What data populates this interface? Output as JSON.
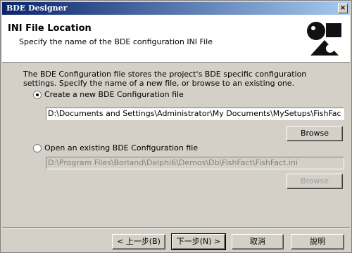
{
  "window": {
    "title": "BDE Designer",
    "close": "×"
  },
  "header": {
    "title": "INI File Location",
    "subtitle": "Specify the name of the BDE configuration INI File"
  },
  "body": {
    "description": "The BDE Configuration file stores the project's BDE specific configuration settings. Specify the name of a new file, or browse to an existing one.",
    "option_create": {
      "label": "Create a new BDE Configuration file",
      "selected": true,
      "path": "D:\\Documents and Settings\\Administrator\\My Documents\\MySetups\\FishFac",
      "browse": "Browse"
    },
    "option_open": {
      "label": "Open an existing BDE Configuration file",
      "selected": false,
      "path": "D:\\Program Files\\Borland\\Delphi6\\Demos\\Db\\FishFact\\FishFact.ini",
      "browse": "Browse"
    }
  },
  "footer": {
    "back": "< 上一步(B)",
    "next": "下一步(N) >",
    "cancel": "取消",
    "help": "說明"
  }
}
